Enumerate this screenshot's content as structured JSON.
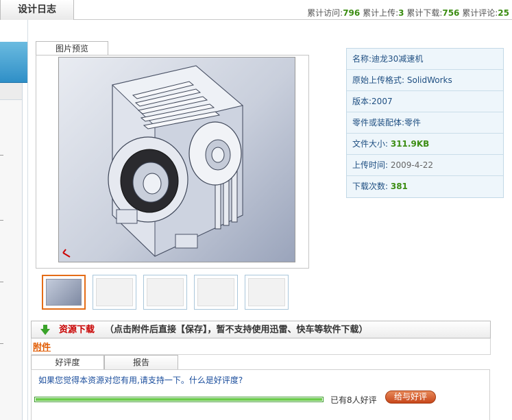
{
  "header": {
    "tab_label": "设计日志",
    "stats": {
      "visits_label": "累计访问:",
      "visits": "796",
      "uploads_label": "累计上传:",
      "uploads": "3",
      "downloads_label": "累计下载:",
      "downloads": "756",
      "comments_label": "累计评论:",
      "comments": "25"
    }
  },
  "preview": {
    "tab_label": "图片预览",
    "thumbnail_count": 5,
    "selected_thumbnail": 1
  },
  "info": {
    "name_label": "名称:",
    "name": "迪龙30减速机",
    "format_label": "原始上传格式: ",
    "format": "SolidWorks",
    "version_label": "版本:",
    "version": "2007",
    "type_label": "零件或装配体:",
    "type": "零件",
    "size_label": "文件大小: ",
    "size": "311.9KB",
    "time_label": "上传时间: ",
    "time": "2009-4-22",
    "downloads_label": "下载次数: ",
    "downloads": "381"
  },
  "download": {
    "title": "资源下载",
    "note": "（点击附件后直接【保存】，暂不支持使用迅雷、快车等软件下载）",
    "attachment_label": "附件"
  },
  "rating": {
    "tabs": [
      {
        "label": "好评度"
      },
      {
        "label": "报告"
      }
    ],
    "question": "如果您觉得本资源对您有用,请支持一下。什么是好评度?",
    "progress": 1.0,
    "count_text": "已有8人好评",
    "button_label": "给与好评"
  },
  "colors": {
    "accent_green": "#3c8d13",
    "title_red": "#c80000",
    "attach_orange": "#e05a00",
    "link_blue": "#1a4d9c"
  }
}
